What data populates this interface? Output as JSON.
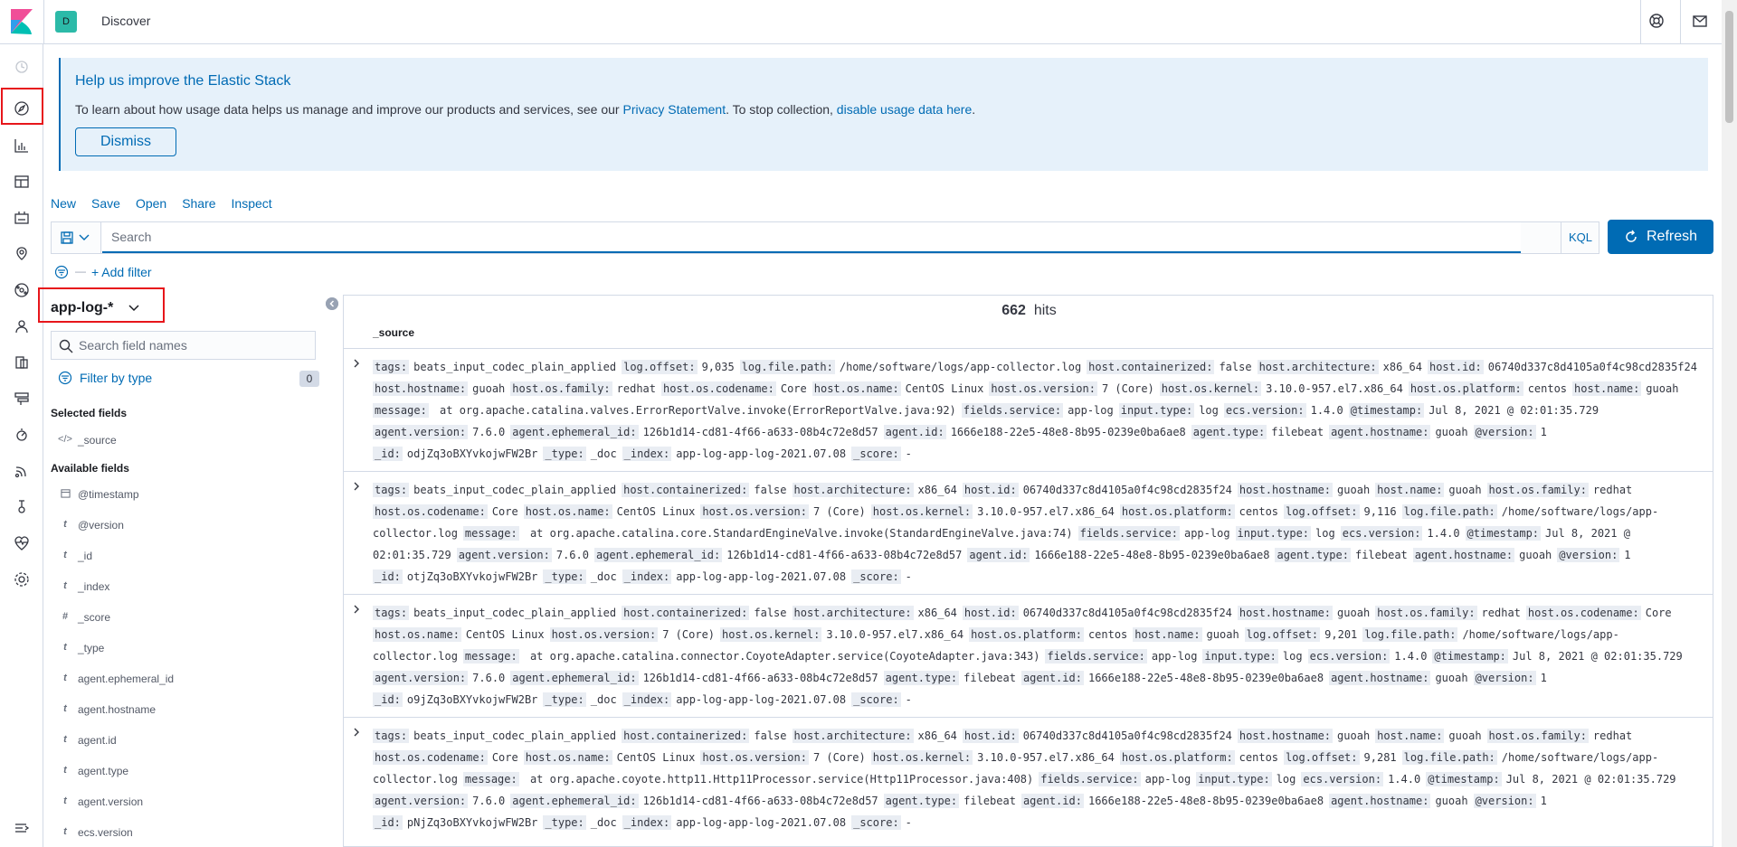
{
  "header": {
    "space_initial": "D",
    "title": "Discover"
  },
  "nav_icons": [
    "clock-icon",
    "compass-icon",
    "visualize-icon",
    "dashboard-icon",
    "canvas-icon",
    "maps-icon",
    "ml-icon",
    "graph-icon",
    "logs-icon",
    "infra-icon",
    "apm-icon",
    "uptime-icon",
    "siem-icon",
    "dev-tools-icon",
    "monitoring-icon",
    "management-icon",
    "collapse-menu-icon"
  ],
  "callout": {
    "title": "Help us improve the Elastic Stack",
    "text_before": "To learn about how usage data helps us manage and improve our products and services, see our",
    "privacy_link": "Privacy Statement",
    "text_middle": ". To stop collection,",
    "disable_link": "disable usage data here",
    "text_end": ".",
    "dismiss": "Dismiss"
  },
  "topnav": {
    "new": "New",
    "save": "Save",
    "open": "Open",
    "share": "Share",
    "inspect": "Inspect"
  },
  "query": {
    "placeholder": "Search",
    "language": "KQL",
    "refresh": "Refresh"
  },
  "filter": {
    "dash": "—",
    "add": "+ Add filter"
  },
  "sidebar": {
    "index_pattern": "app-log-*",
    "search_placeholder": "Search field names",
    "filter_by_type": "Filter by type",
    "filter_count": "0",
    "selected_title": "Selected fields",
    "selected": [
      {
        "type": "</>",
        "name": "_source"
      }
    ],
    "available_title": "Available fields",
    "available": [
      {
        "type": "cal",
        "name": "@timestamp"
      },
      {
        "type": "t",
        "name": "@version"
      },
      {
        "type": "t",
        "name": "_id"
      },
      {
        "type": "t",
        "name": "_index"
      },
      {
        "type": "#",
        "name": "_score"
      },
      {
        "type": "t",
        "name": "_type"
      },
      {
        "type": "t",
        "name": "agent.ephemeral_id"
      },
      {
        "type": "t",
        "name": "agent.hostname"
      },
      {
        "type": "t",
        "name": "agent.id"
      },
      {
        "type": "t",
        "name": "agent.type"
      },
      {
        "type": "t",
        "name": "agent.version"
      },
      {
        "type": "t",
        "name": "ecs.version"
      }
    ]
  },
  "results": {
    "hits_count": "662",
    "hits_label": "hits",
    "column": "_source",
    "docs": [
      [
        [
          [
            "tags:",
            "beats_input_codec_plain_applied"
          ],
          [
            "log.offset:",
            "9,035"
          ],
          [
            "log.file.path:",
            "/home/software/logs/app-collector.log"
          ],
          [
            "host.containerized:",
            "false"
          ],
          [
            "host.architecture:",
            "x86_64"
          ],
          [
            "host.id:",
            "06740d337c8d4105a0f4c98cd2835f24"
          ]
        ],
        [
          [
            "host.hostname:",
            "guoah"
          ],
          [
            "host.os.family:",
            "redhat"
          ],
          [
            "host.os.codename:",
            "Core"
          ],
          [
            "host.os.name:",
            "CentOS Linux"
          ],
          [
            "host.os.version:",
            "7 (Core)"
          ],
          [
            "host.os.kernel:",
            "3.10.0-957.el7.x86_64"
          ],
          [
            "host.os.platform:",
            "centos"
          ],
          [
            "host.name:",
            "guoah"
          ]
        ],
        [
          [
            "message:",
            "  at org.apache.catalina.valves.ErrorReportValve.invoke(ErrorReportValve.java:92)"
          ],
          [
            "fields.service:",
            "app-log"
          ],
          [
            "input.type:",
            "log"
          ],
          [
            "ecs.version:",
            "1.4.0"
          ],
          [
            "@timestamp:",
            "Jul 8, 2021 @ 02:01:35.729"
          ]
        ],
        [
          [
            "agent.version:",
            "7.6.0"
          ],
          [
            "agent.ephemeral_id:",
            "126b1d14-cd81-4f66-a633-08b4c72e8d57"
          ],
          [
            "agent.id:",
            "1666e188-22e5-48e8-8b95-0239e0ba6ae8"
          ],
          [
            "agent.type:",
            "filebeat"
          ],
          [
            "agent.hostname:",
            "guoah"
          ],
          [
            "@version:",
            "1"
          ]
        ],
        [
          [
            "_id:",
            "odjZq3oBXYvkojwFW2Br"
          ],
          [
            "_type:",
            "_doc"
          ],
          [
            "_index:",
            "app-log-app-log-2021.07.08"
          ],
          [
            "_score:",
            "-"
          ]
        ]
      ],
      [
        [
          [
            "tags:",
            "beats_input_codec_plain_applied"
          ],
          [
            "host.containerized:",
            "false"
          ],
          [
            "host.architecture:",
            "x86_64"
          ],
          [
            "host.id:",
            "06740d337c8d4105a0f4c98cd2835f24"
          ],
          [
            "host.hostname:",
            "guoah"
          ],
          [
            "host.name:",
            "guoah"
          ],
          [
            "host.os.family:",
            "redhat"
          ]
        ],
        [
          [
            "host.os.codename:",
            "Core"
          ],
          [
            "host.os.name:",
            "CentOS Linux"
          ],
          [
            "host.os.version:",
            "7 (Core)"
          ],
          [
            "host.os.kernel:",
            "3.10.0-957.el7.x86_64"
          ],
          [
            "host.os.platform:",
            "centos"
          ],
          [
            "log.offset:",
            "9,116"
          ],
          [
            "log.file.path:",
            "/home/software/logs/app-"
          ]
        ],
        [
          [
            "",
            "collector.log"
          ],
          [
            "message:",
            "  at org.apache.catalina.core.StandardEngineValve.invoke(StandardEngineValve.java:74)"
          ],
          [
            "fields.service:",
            "app-log"
          ],
          [
            "input.type:",
            "log"
          ],
          [
            "ecs.version:",
            "1.4.0"
          ],
          [
            "@timestamp:",
            "Jul 8, 2021 @"
          ]
        ],
        [
          [
            "",
            "02:01:35.729"
          ],
          [
            "agent.version:",
            "7.6.0"
          ],
          [
            "agent.ephemeral_id:",
            "126b1d14-cd81-4f66-a633-08b4c72e8d57"
          ],
          [
            "agent.id:",
            "1666e188-22e5-48e8-8b95-0239e0ba6ae8"
          ],
          [
            "agent.type:",
            "filebeat"
          ],
          [
            "agent.hostname:",
            "guoah"
          ],
          [
            "@version:",
            "1"
          ]
        ],
        [
          [
            "_id:",
            "otjZq3oBXYvkojwFW2Br"
          ],
          [
            "_type:",
            "_doc"
          ],
          [
            "_index:",
            "app-log-app-log-2021.07.08"
          ],
          [
            "_score:",
            "-"
          ]
        ]
      ],
      [
        [
          [
            "tags:",
            "beats_input_codec_plain_applied"
          ],
          [
            "host.containerized:",
            "false"
          ],
          [
            "host.architecture:",
            "x86_64"
          ],
          [
            "host.id:",
            "06740d337c8d4105a0f4c98cd2835f24"
          ],
          [
            "host.hostname:",
            "guoah"
          ],
          [
            "host.os.family:",
            "redhat"
          ],
          [
            "host.os.codename:",
            "Core"
          ]
        ],
        [
          [
            "host.os.name:",
            "CentOS Linux"
          ],
          [
            "host.os.version:",
            "7 (Core)"
          ],
          [
            "host.os.kernel:",
            "3.10.0-957.el7.x86_64"
          ],
          [
            "host.os.platform:",
            "centos"
          ],
          [
            "host.name:",
            "guoah"
          ],
          [
            "log.offset:",
            "9,201"
          ],
          [
            "log.file.path:",
            "/home/software/logs/app-"
          ]
        ],
        [
          [
            "",
            "collector.log"
          ],
          [
            "message:",
            "  at org.apache.catalina.connector.CoyoteAdapter.service(CoyoteAdapter.java:343)"
          ],
          [
            "fields.service:",
            "app-log"
          ],
          [
            "input.type:",
            "log"
          ],
          [
            "ecs.version:",
            "1.4.0"
          ],
          [
            "@timestamp:",
            "Jul 8, 2021 @ 02:01:35.729"
          ]
        ],
        [
          [
            "agent.version:",
            "7.6.0"
          ],
          [
            "agent.ephemeral_id:",
            "126b1d14-cd81-4f66-a633-08b4c72e8d57"
          ],
          [
            "agent.type:",
            "filebeat"
          ],
          [
            "agent.id:",
            "1666e188-22e5-48e8-8b95-0239e0ba6ae8"
          ],
          [
            "agent.hostname:",
            "guoah"
          ],
          [
            "@version:",
            "1"
          ]
        ],
        [
          [
            "_id:",
            "o9jZq3oBXYvkojwFW2Br"
          ],
          [
            "_type:",
            "_doc"
          ],
          [
            "_index:",
            "app-log-app-log-2021.07.08"
          ],
          [
            "_score:",
            "-"
          ]
        ]
      ],
      [
        [
          [
            "tags:",
            "beats_input_codec_plain_applied"
          ],
          [
            "host.containerized:",
            "false"
          ],
          [
            "host.architecture:",
            "x86_64"
          ],
          [
            "host.id:",
            "06740d337c8d4105a0f4c98cd2835f24"
          ],
          [
            "host.hostname:",
            "guoah"
          ],
          [
            "host.name:",
            "guoah"
          ],
          [
            "host.os.family:",
            "redhat"
          ]
        ],
        [
          [
            "host.os.codename:",
            "Core"
          ],
          [
            "host.os.name:",
            "CentOS Linux"
          ],
          [
            "host.os.version:",
            "7 (Core)"
          ],
          [
            "host.os.kernel:",
            "3.10.0-957.el7.x86_64"
          ],
          [
            "host.os.platform:",
            "centos"
          ],
          [
            "log.offset:",
            "9,281"
          ],
          [
            "log.file.path:",
            "/home/software/logs/app-"
          ]
        ],
        [
          [
            "",
            "collector.log"
          ],
          [
            "message:",
            "  at org.apache.coyote.http11.Http11Processor.service(Http11Processor.java:408)"
          ],
          [
            "fields.service:",
            "app-log"
          ],
          [
            "input.type:",
            "log"
          ],
          [
            "ecs.version:",
            "1.4.0"
          ],
          [
            "@timestamp:",
            "Jul 8, 2021 @ 02:01:35.729"
          ]
        ],
        [
          [
            "agent.version:",
            "7.6.0"
          ],
          [
            "agent.ephemeral_id:",
            "126b1d14-cd81-4f66-a633-08b4c72e8d57"
          ],
          [
            "agent.type:",
            "filebeat"
          ],
          [
            "agent.id:",
            "1666e188-22e5-48e8-8b95-0239e0ba6ae8"
          ],
          [
            "agent.hostname:",
            "guoah"
          ],
          [
            "@version:",
            "1"
          ]
        ],
        [
          [
            "_id:",
            "pNjZq3oBXYvkojwFW2Br"
          ],
          [
            "_type:",
            "_doc"
          ],
          [
            "_index:",
            "app-log-app-log-2021.07.08"
          ],
          [
            "_score:",
            "-"
          ]
        ]
      ]
    ]
  }
}
